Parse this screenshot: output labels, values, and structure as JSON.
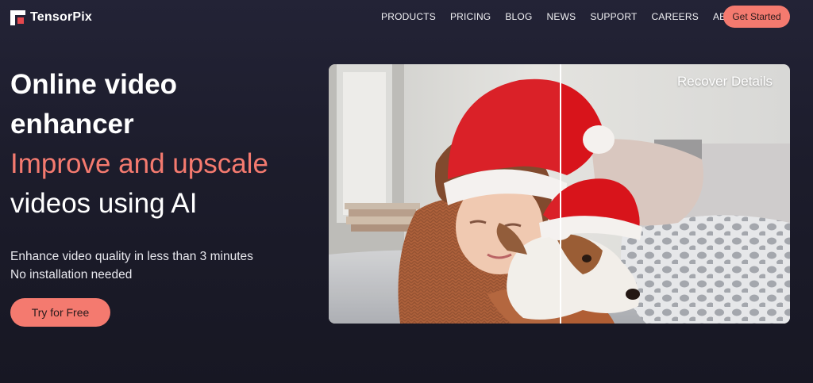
{
  "brand": {
    "name": "TensorPix"
  },
  "nav": {
    "items": [
      "PRODUCTS",
      "PRICING",
      "BLOG",
      "NEWS",
      "SUPPORT",
      "CAREERS",
      "ABOUT"
    ],
    "cta": "Get Started"
  },
  "hero": {
    "line1": "Online video",
    "line2": "enhancer",
    "line3": "Improve and upscale",
    "line4": "videos using AI",
    "sub1": "Enhance video quality in less than 3 minutes",
    "sub2": "No installation needed",
    "cta": "Try for Free"
  },
  "media": {
    "label": "Recover Details",
    "comparison_split": 0.5
  },
  "colors": {
    "accent": "#f47a6f",
    "background": "#1e1e2e",
    "text": "#ffffff"
  }
}
